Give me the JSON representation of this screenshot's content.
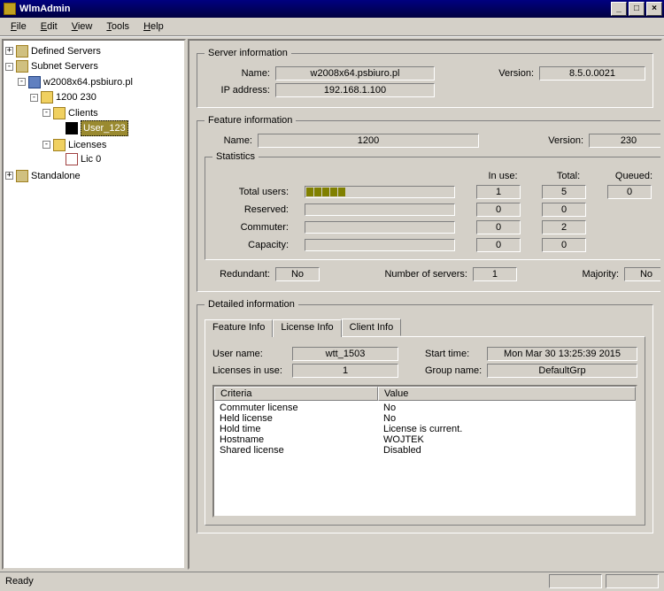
{
  "window": {
    "title": "WlmAdmin"
  },
  "menu": [
    "File",
    "Edit",
    "View",
    "Tools",
    "Help"
  ],
  "tree": {
    "defined": "Defined Servers",
    "subnet": "Subnet Servers",
    "host": "w2008x64.psbiuro.pl",
    "feature": "1200 230",
    "clients": "Clients",
    "client1": "User_123",
    "licenses": "Licenses",
    "lic0": "Lic 0",
    "standalone": "Standalone"
  },
  "server_info": {
    "legend": "Server information",
    "name_lbl": "Name:",
    "name": "w2008x64.psbiuro.pl",
    "version_lbl": "Version:",
    "version": "8.5.0.0021",
    "ip_lbl": "IP address:",
    "ip": "192.168.1.100"
  },
  "feature_info": {
    "legend": "Feature information",
    "name_lbl": "Name:",
    "name": "1200",
    "version_lbl": "Version:",
    "version": "230",
    "stats_legend": "Statistics",
    "hdr_inuse": "In use:",
    "hdr_total": "Total:",
    "hdr_queued": "Queued:",
    "rows": {
      "total_users": {
        "label": "Total users:",
        "inuse": "1",
        "total": "5",
        "queued": "0"
      },
      "reserved": {
        "label": "Reserved:",
        "inuse": "0",
        "total": "0",
        "queued": ""
      },
      "commuter": {
        "label": "Commuter:",
        "inuse": "0",
        "total": "2",
        "queued": ""
      },
      "capacity": {
        "label": "Capacity:",
        "inuse": "0",
        "total": "0",
        "queued": ""
      }
    },
    "redundant_lbl": "Redundant:",
    "redundant": "No",
    "numservers_lbl": "Number of servers:",
    "numservers": "1",
    "majority_lbl": "Majority:",
    "majority": "No"
  },
  "detailed": {
    "legend": "Detailed information",
    "tabs": {
      "feature": "Feature Info",
      "license": "License Info",
      "client": "Client Info"
    },
    "client": {
      "user_lbl": "User name:",
      "user": "wtt_1503",
      "start_lbl": "Start time:",
      "start": "Mon Mar 30 13:25:39 2015",
      "lic_lbl": "Licenses in use:",
      "lic": "1",
      "group_lbl": "Group name:",
      "group": "DefaultGrp",
      "col_criteria": "Criteria",
      "col_value": "Value",
      "rows": [
        {
          "c": "Commuter license",
          "v": "No"
        },
        {
          "c": "Held license",
          "v": "No"
        },
        {
          "c": "Hold time",
          "v": "License is current."
        },
        {
          "c": "Hostname",
          "v": "WOJTEK"
        },
        {
          "c": "Shared license",
          "v": "Disabled"
        }
      ]
    }
  },
  "status": "Ready"
}
